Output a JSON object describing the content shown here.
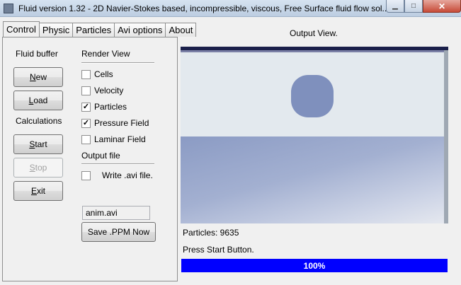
{
  "window": {
    "title": "Fluid version 1.32 - 2D Navier-Stokes based, incompressible, viscous, Free Surface fluid flow sol...",
    "min_glyph": "▁",
    "max_glyph": "□",
    "close_glyph": "✕"
  },
  "tabs": [
    {
      "label": "Control",
      "active": true
    },
    {
      "label": "Physic"
    },
    {
      "label": "Particles"
    },
    {
      "label": "Avi options"
    },
    {
      "label": "About"
    }
  ],
  "control": {
    "fluid_buffer_label": "Fluid buffer",
    "new_button": {
      "mnemonic": "N",
      "rest": "ew"
    },
    "load_button": {
      "mnemonic": "L",
      "rest": "oad"
    },
    "calculations_label": "Calculations",
    "start_button": {
      "mnemonic": "S",
      "rest": "tart"
    },
    "stop_button": {
      "mnemonic": "S",
      "rest": "top"
    },
    "exit_button": {
      "mnemonic": "E",
      "rest": "xit"
    },
    "render_view_label": "Render View",
    "render_options": [
      {
        "label": "Cells",
        "checked": false,
        "mark": ""
      },
      {
        "label": "Velocity",
        "checked": false,
        "mark": ""
      },
      {
        "label": "Particles",
        "checked": true,
        "mark": "✓"
      },
      {
        "label": "Pressure Field",
        "checked": true,
        "mark": "✓"
      },
      {
        "label": "Laminar Field",
        "checked": false,
        "mark": ""
      }
    ],
    "output_file_label": "Output file",
    "write_avi": {
      "label": "Write .avi file.",
      "checked": false,
      "mark": ""
    },
    "avi_filename": "anim.avi",
    "save_ppm_label": "Save .PPM Now"
  },
  "output": {
    "title": "Output View.",
    "particles_text": "Particles: 9635",
    "status_text": "Press Start Button.",
    "progress_percent": 100,
    "progress_text": "100%"
  },
  "colors": {
    "progress_fill": "#0000ff",
    "fluid": "#8b9bc4",
    "droplet": "#7f90bd",
    "background": "#e3e9ee"
  },
  "icons": {
    "app": "fluid-app-icon",
    "minimize": "minimize-icon",
    "maximize": "maximize-icon",
    "close": "close-icon",
    "check": "check-icon"
  }
}
